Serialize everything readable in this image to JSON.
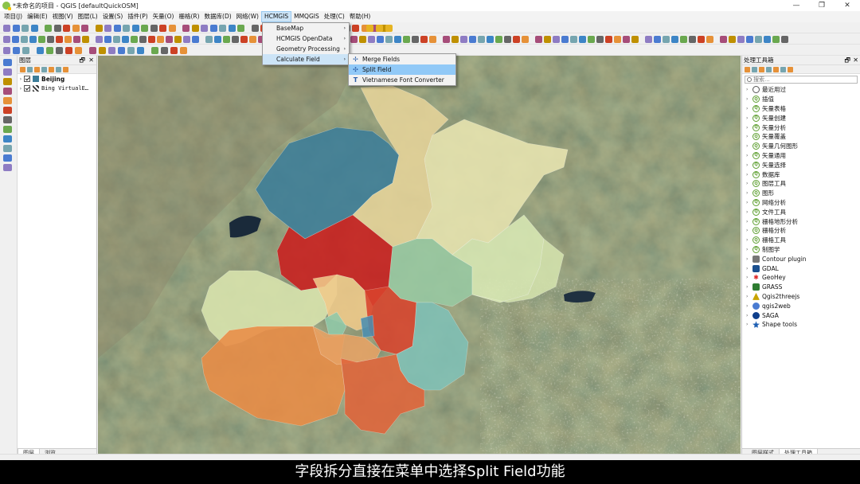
{
  "window": {
    "title": "*未命名的项目 - QGIS [defaultQuickOSM]",
    "controls": [
      "—",
      "❐",
      "✕"
    ]
  },
  "menubar": [
    {
      "label": "项目(J)"
    },
    {
      "label": "编辑(E)"
    },
    {
      "label": "视图(V)"
    },
    {
      "label": "图层(L)"
    },
    {
      "label": "设置(S)"
    },
    {
      "label": "插件(P)"
    },
    {
      "label": "矢量(O)"
    },
    {
      "label": "栅格(R)"
    },
    {
      "label": "数据库(D)"
    },
    {
      "label": "网络(W)"
    },
    {
      "label": "HCMGIS"
    },
    {
      "label": "MMQGIS"
    },
    {
      "label": "处理(C)"
    },
    {
      "label": "帮助(H)"
    }
  ],
  "hcmgis_menu": [
    {
      "label": "BaseMap",
      "submenu": "›"
    },
    {
      "label": "HCMGIS OpenData",
      "submenu": "›"
    },
    {
      "label": "Geometry Processing",
      "submenu": "›"
    },
    {
      "label": "Calculate Field",
      "submenu": "›"
    }
  ],
  "calc_submenu": [
    {
      "label": "Merge Fields",
      "icon": "merge-icon",
      "glyph": "✢"
    },
    {
      "label": "Split Field",
      "icon": "split-icon",
      "glyph": "✣"
    },
    {
      "label": "Vietnamese Font Converter",
      "icon": "font-icon",
      "glyph": "T"
    }
  ],
  "layers_panel": {
    "title": "图层",
    "pin": "🗗",
    "close": "✕",
    "layers": [
      {
        "name": "Beijing",
        "arrow": "›",
        "symbol_color": "#3c7d99"
      },
      {
        "name": "Bing VirtualE…",
        "arrow": "›",
        "symbol_color": "#333333"
      }
    ],
    "tabs": [
      "图层",
      "浏览"
    ]
  },
  "processing_panel": {
    "title": "处理工具箱",
    "pin": "🗗",
    "close": "✕",
    "search_placeholder": "搜索...",
    "items": [
      {
        "label": "最近用过",
        "icon": "clock"
      },
      {
        "label": "插值",
        "icon": "q"
      },
      {
        "label": "矢量表格",
        "icon": "q"
      },
      {
        "label": "矢量创建",
        "icon": "q"
      },
      {
        "label": "矢量分析",
        "icon": "q"
      },
      {
        "label": "矢量覆盖",
        "icon": "q"
      },
      {
        "label": "矢量几何图形",
        "icon": "q"
      },
      {
        "label": "矢量通用",
        "icon": "q"
      },
      {
        "label": "矢量选择",
        "icon": "q"
      },
      {
        "label": "数据库",
        "icon": "q"
      },
      {
        "label": "图层工具",
        "icon": "q"
      },
      {
        "label": "图形",
        "icon": "q"
      },
      {
        "label": "网络分析",
        "icon": "q"
      },
      {
        "label": "文件工具",
        "icon": "q"
      },
      {
        "label": "栅格地形分析",
        "icon": "q"
      },
      {
        "label": "栅格分析",
        "icon": "q"
      },
      {
        "label": "栅格工具",
        "icon": "q"
      },
      {
        "label": "制图学",
        "icon": "q"
      },
      {
        "label": "Contour plugin",
        "icon": "contour"
      },
      {
        "label": "GDAL",
        "icon": "gdal"
      },
      {
        "label": "GeoHey",
        "icon": "geohey"
      },
      {
        "label": "GRASS",
        "icon": "grass"
      },
      {
        "label": "Qgis2threejs",
        "icon": "three"
      },
      {
        "label": "qgis2web",
        "icon": "web"
      },
      {
        "label": "SAGA",
        "icon": "saga"
      },
      {
        "label": "Shape tools",
        "icon": "shape"
      }
    ],
    "tabs": [
      "图层样式",
      "处理工具箱"
    ]
  },
  "map": {
    "layer_name": "Beijing",
    "district_colors": [
      "#3c7d99",
      "#e6d49a",
      "#e8e5b0",
      "#c91e1e",
      "#98c9a3",
      "#d8e8b4",
      "#d9e5ae",
      "#efc98a",
      "#d8432c",
      "#8fc8a8",
      "#4a8eb0",
      "#e98c45",
      "#e6a264",
      "#e0643a",
      "#7fc0b6",
      "#d4e3ad"
    ]
  },
  "subtitle": "字段拆分直接在菜单中选择Split Field功能"
}
